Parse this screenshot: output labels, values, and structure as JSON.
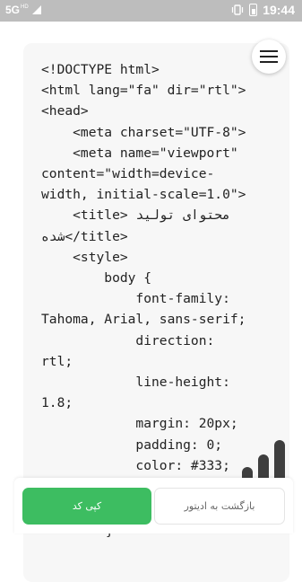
{
  "status_bar": {
    "network": "5G",
    "network_sup": "HD",
    "time": "19:44",
    "icons": [
      "signal-icon",
      "vibrate-icon",
      "battery-icon"
    ]
  },
  "code_lines": [
    "<!DOCTYPE html>",
    "<html lang=\"fa\" dir=\"rtl\">",
    "<head>",
    "    <meta charset=\"UTF-8\">",
    "    <meta name=\"viewport\"",
    "content=\"width=device-",
    "width, initial-scale=1.0\">",
    "    <title> محتوای تولید",
    "شده</title>",
    "    <style>",
    "        body {",
    "            font-family:",
    "Tahoma, Arial, sans-serif;",
    "            direction:",
    "rtl;",
    "            line-height:",
    "1.8;",
    "            margin: 20px;",
    "            padding: 0;",
    "            color: #333;"
  ],
  "trailing_char": "}",
  "buttons": {
    "copy_label": "کپی کد",
    "back_label": "بازگشت به ادیتور"
  },
  "colors": {
    "accent": "#3dbd61",
    "status_bar": "#bdbdbd",
    "card": "#f7f7f7"
  },
  "icons": {
    "menu": "hamburger-menu-icon",
    "watermark": "app-logo-watermark"
  }
}
